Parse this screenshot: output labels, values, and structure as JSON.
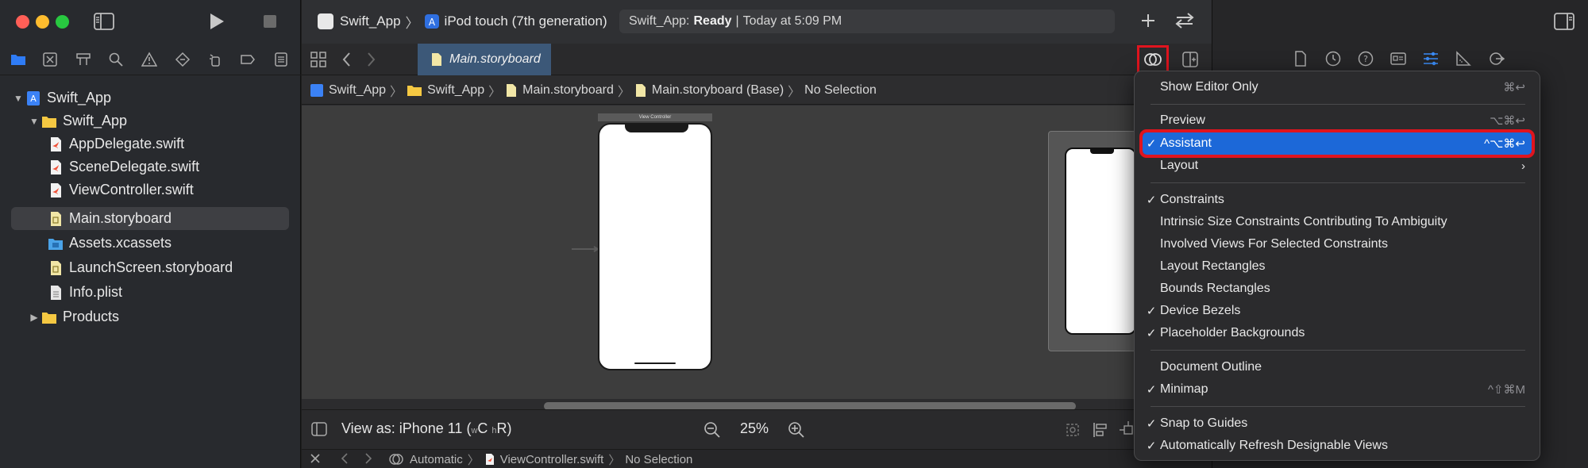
{
  "app": {
    "scheme": "Swift_App",
    "device": "iPod touch (7th generation)",
    "status_app": "Swift_App:",
    "status_state": "Ready",
    "status_sep": "|",
    "status_time": "Today at 5:09 PM"
  },
  "tabs": [
    {
      "label": "Main.storyboard"
    }
  ],
  "jumpbar": {
    "items": [
      "Swift_App",
      "Swift_App",
      "Main.storyboard",
      "Main.storyboard (Base)",
      "No Selection"
    ]
  },
  "navigator": {
    "items": [
      {
        "label": "Swift_App",
        "type": "project",
        "level": 0,
        "disclosure": "open"
      },
      {
        "label": "Swift_App",
        "type": "folder",
        "level": 1,
        "disclosure": "open"
      },
      {
        "label": "AppDelegate.swift",
        "type": "swift",
        "level": 2
      },
      {
        "label": "SceneDelegate.swift",
        "type": "swift",
        "level": 2
      },
      {
        "label": "ViewController.swift",
        "type": "swift",
        "level": 2
      },
      {
        "label": "Main.storyboard",
        "type": "storyboard",
        "level": 2,
        "selected": true
      },
      {
        "label": "Assets.xcassets",
        "type": "assets",
        "level": 2
      },
      {
        "label": "LaunchScreen.storyboard",
        "type": "storyboard",
        "level": 2
      },
      {
        "label": "Info.plist",
        "type": "plist",
        "level": 2
      },
      {
        "label": "Products",
        "type": "folder",
        "level": 1,
        "disclosure": "closed"
      }
    ]
  },
  "canvas": {
    "scene_title": "View Controller"
  },
  "bottombar": {
    "view_as_prefix": "View as: iPhone 11 (",
    "w_label": "w",
    "c_label": "C",
    "h_label": "h",
    "r_label": "R)",
    "zoom": "25%"
  },
  "debugbar": {
    "mode": "Automatic",
    "file": "ViewController.swift",
    "selection": "No Selection"
  },
  "menu": {
    "items": [
      {
        "label": "Show Editor Only",
        "checked": false,
        "shortcut": "⌘↩",
        "submenu": false
      },
      {
        "label": "Preview",
        "checked": false,
        "shortcut": "⌥⌘↩",
        "submenu": false
      },
      {
        "label": "Assistant",
        "checked": true,
        "shortcut": "^⌥⌘↩",
        "submenu": false,
        "highlighted": true
      },
      {
        "label": "Layout",
        "checked": false,
        "shortcut": "",
        "submenu": true
      },
      {
        "label": "Constraints",
        "checked": true,
        "shortcut": "",
        "submenu": false
      },
      {
        "label": "Intrinsic Size Constraints Contributing To Ambiguity",
        "checked": false,
        "shortcut": "",
        "submenu": false
      },
      {
        "label": "Involved Views For Selected Constraints",
        "checked": false,
        "shortcut": "",
        "submenu": false
      },
      {
        "label": "Layout Rectangles",
        "checked": false,
        "shortcut": "",
        "submenu": false
      },
      {
        "label": "Bounds Rectangles",
        "checked": false,
        "shortcut": "",
        "submenu": false
      },
      {
        "label": "Device Bezels",
        "checked": true,
        "shortcut": "",
        "submenu": false
      },
      {
        "label": "Placeholder Backgrounds",
        "checked": true,
        "shortcut": "",
        "submenu": false
      },
      {
        "label": "Document Outline",
        "checked": false,
        "shortcut": "",
        "submenu": false
      },
      {
        "label": "Minimap",
        "checked": true,
        "shortcut": "^⇧⌘M",
        "submenu": false
      },
      {
        "label": "Snap to Guides",
        "checked": true,
        "shortcut": "",
        "submenu": false
      },
      {
        "label": "Automatically Refresh Designable Views",
        "checked": true,
        "shortcut": "",
        "submenu": false
      }
    ]
  },
  "colors": {
    "accent": "#1c68d8",
    "highlight_outline": "#e0141e",
    "folder": "#f5c842",
    "swift": "#f05138"
  }
}
